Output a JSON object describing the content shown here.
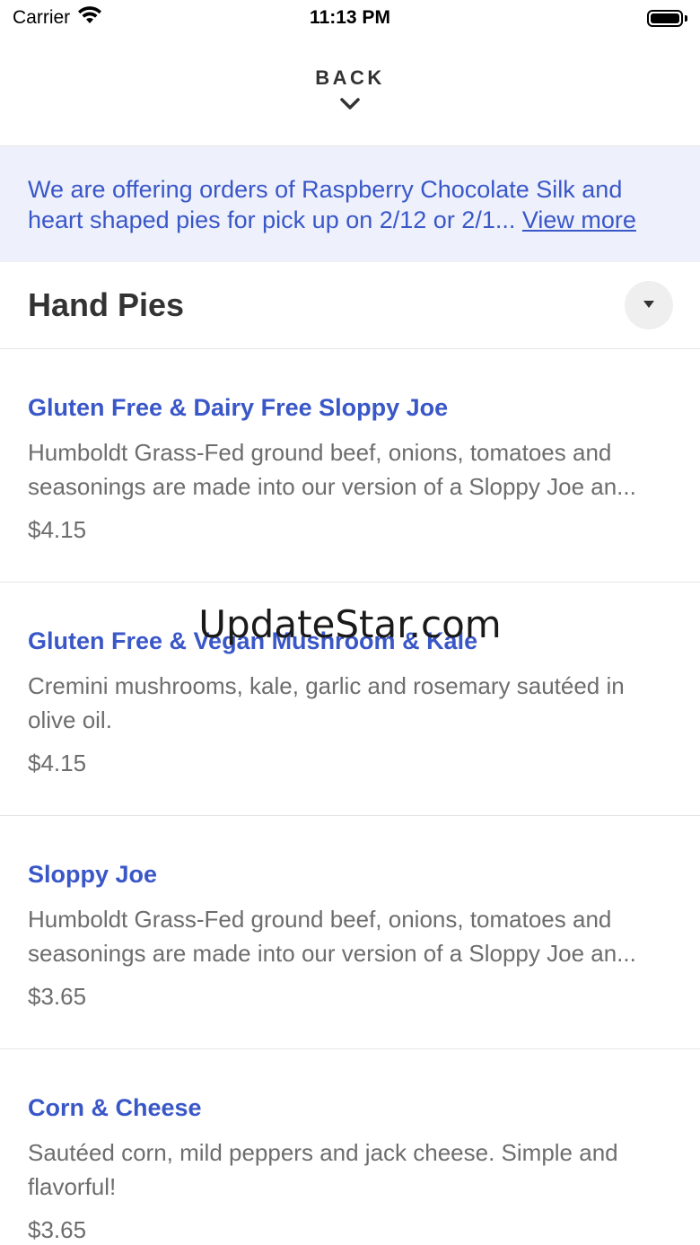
{
  "status_bar": {
    "carrier": "Carrier",
    "time": "11:13 PM"
  },
  "header": {
    "back_label": "BACK",
    "chevron_icon": "chevron-down-icon"
  },
  "announcement": {
    "text": "We are offering orders of Raspberry Chocolate Silk and heart shaped pies for pick up on 2/12 or 2/1...",
    "view_more": "View more"
  },
  "section": {
    "title": "Hand Pies",
    "toggle_icon": "caret-down-icon"
  },
  "items": [
    {
      "name": "Gluten Free & Dairy Free Sloppy Joe",
      "description": "Humboldt Grass-Fed ground beef, onions, tomatoes and seasonings are made into our version of a Sloppy Joe an...",
      "price": "$4.15"
    },
    {
      "name": "Gluten Free & Vegan Mushroom & Kale",
      "description": "Cremini mushrooms, kale, garlic and rosemary sautéed in olive oil.",
      "price": "$4.15"
    },
    {
      "name": "Sloppy Joe",
      "description": "Humboldt Grass-Fed ground beef, onions, tomatoes and seasonings are made into our version of a Sloppy Joe an...",
      "price": "$3.65"
    },
    {
      "name": "Corn & Cheese",
      "description": "Sautéed corn, mild peppers and jack cheese. Simple and flavorful!",
      "price": "$3.65"
    }
  ],
  "watermark": "UpdateStar.com",
  "colors": {
    "accent": "#3a57c8",
    "banner_bg": "#eef1fb",
    "text_muted": "#6d6d6d",
    "divider": "#e6e6e6"
  }
}
